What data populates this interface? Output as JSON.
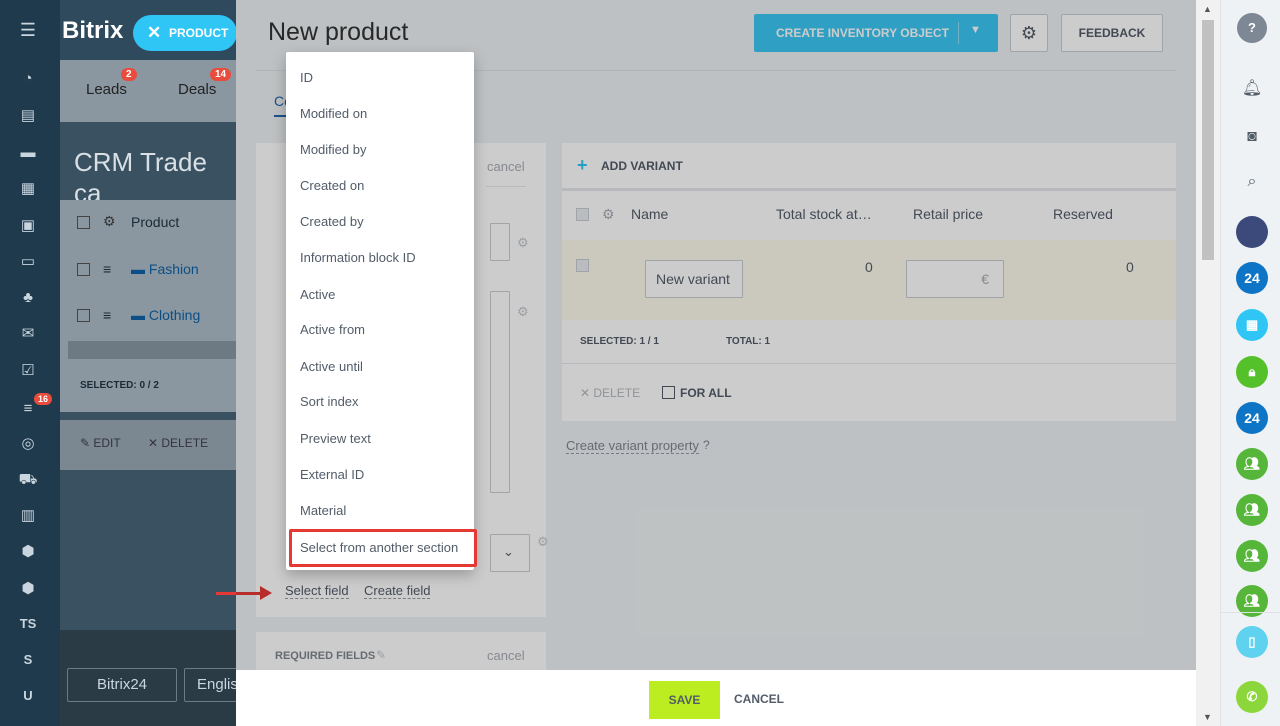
{
  "app": {
    "logo": "Bitrix",
    "slider_title": "New product"
  },
  "pill": {
    "label": "PRODUCT"
  },
  "bg": {
    "tabs": [
      {
        "label": "Leads",
        "badge": "2"
      },
      {
        "label": "Deals",
        "badge": "14"
      }
    ],
    "title": "CRM Trade ca",
    "grid_header": "Product",
    "rows": [
      "Fashion",
      "Clothing"
    ],
    "selected": "SELECTED: 0 / 2",
    "edit": "EDIT",
    "delete": "DELETE",
    "bottom_btn1": "Bitrix24",
    "bottom_btn2": "Englis",
    "nav_badge": "16",
    "nav_ts": "TS",
    "nav_s": "S",
    "nav_u": "U"
  },
  "toolbar": {
    "create_inventory": "CREATE INVENTORY OBJECT",
    "feedback": "FEEDBACK",
    "tab_common": "Co"
  },
  "left_card": {
    "cancel": "cancel",
    "select_field": "Select field",
    "create_field": "Create field"
  },
  "required_card": {
    "label": "REQUIRED FIELDS",
    "cancel": "cancel"
  },
  "variants": {
    "add_variant": "ADD VARIANT",
    "columns": [
      "Name",
      "Total stock at…",
      "Retail price",
      "Reserved"
    ],
    "row": {
      "name": "New variant",
      "stock": "0",
      "currency": "€",
      "reserved": "0"
    },
    "selected": "SELECTED: 1 / 1",
    "total": "TOTAL: 1",
    "delete": "DELETE",
    "for_all": "FOR ALL",
    "create_property": "Create variant property"
  },
  "menu": {
    "items": [
      "ID",
      "Modified on",
      "Modified by",
      "Created on",
      "Created by",
      "Information block ID",
      "Active",
      "Active from",
      "Active until",
      "Sort index",
      "Preview text",
      "External ID",
      "Material",
      "Select from another section"
    ]
  },
  "footer": {
    "save": "SAVE",
    "cancel": "CANCEL"
  },
  "rightrail": {
    "badge_24": "24"
  }
}
